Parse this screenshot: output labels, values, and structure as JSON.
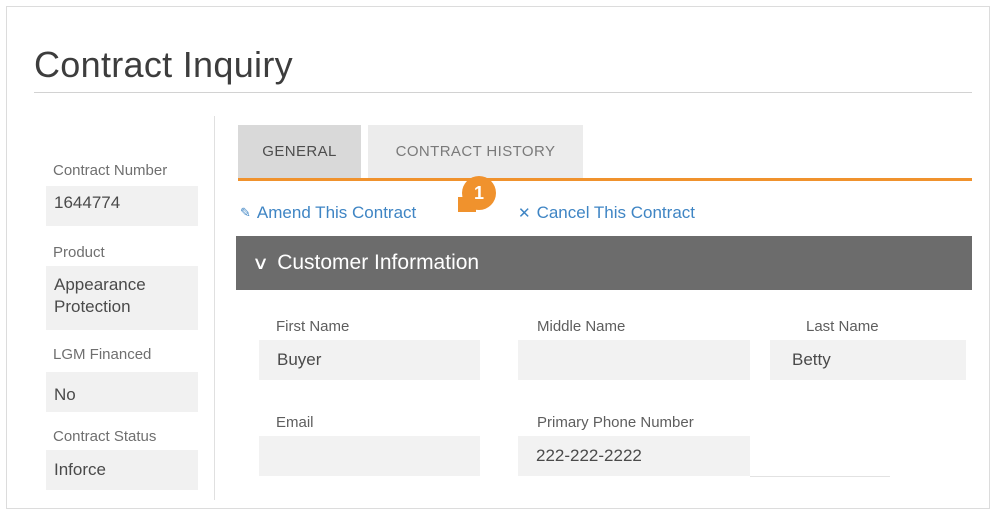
{
  "page": {
    "title": "Contract Inquiry"
  },
  "sidebar": {
    "items": [
      {
        "label": "Contract Number",
        "value": "1644774"
      },
      {
        "label": "Product",
        "value_line1": "Appearance",
        "value_line2": "Protection"
      },
      {
        "label": "LGM Financed",
        "value": "No"
      },
      {
        "label": "Contract Status",
        "value": "Inforce"
      }
    ]
  },
  "tabs": [
    {
      "label": "GENERAL",
      "active": true
    },
    {
      "label": "CONTRACT HISTORY",
      "active": false
    }
  ],
  "actions": {
    "amend": {
      "icon": "pencil-icon",
      "label": "Amend This Contract"
    },
    "cancel": {
      "icon": "close-icon",
      "label": "Cancel This Contract"
    }
  },
  "callout": {
    "number": "1"
  },
  "section": {
    "title": "Customer Information",
    "icon": "chevron-down-icon"
  },
  "fields": {
    "first_name": {
      "label": "First Name",
      "value": "Buyer"
    },
    "middle_name": {
      "label": "Middle Name",
      "value": ""
    },
    "last_name": {
      "label": "Last Name",
      "value": "Betty"
    },
    "email": {
      "label": "Email",
      "value": ""
    },
    "phone": {
      "label": "Primary Phone Number",
      "value": "222-222-2222"
    }
  },
  "colors": {
    "accent": "#f0922d",
    "link": "#3f85c4",
    "section_bar": "#6c6c6c"
  }
}
